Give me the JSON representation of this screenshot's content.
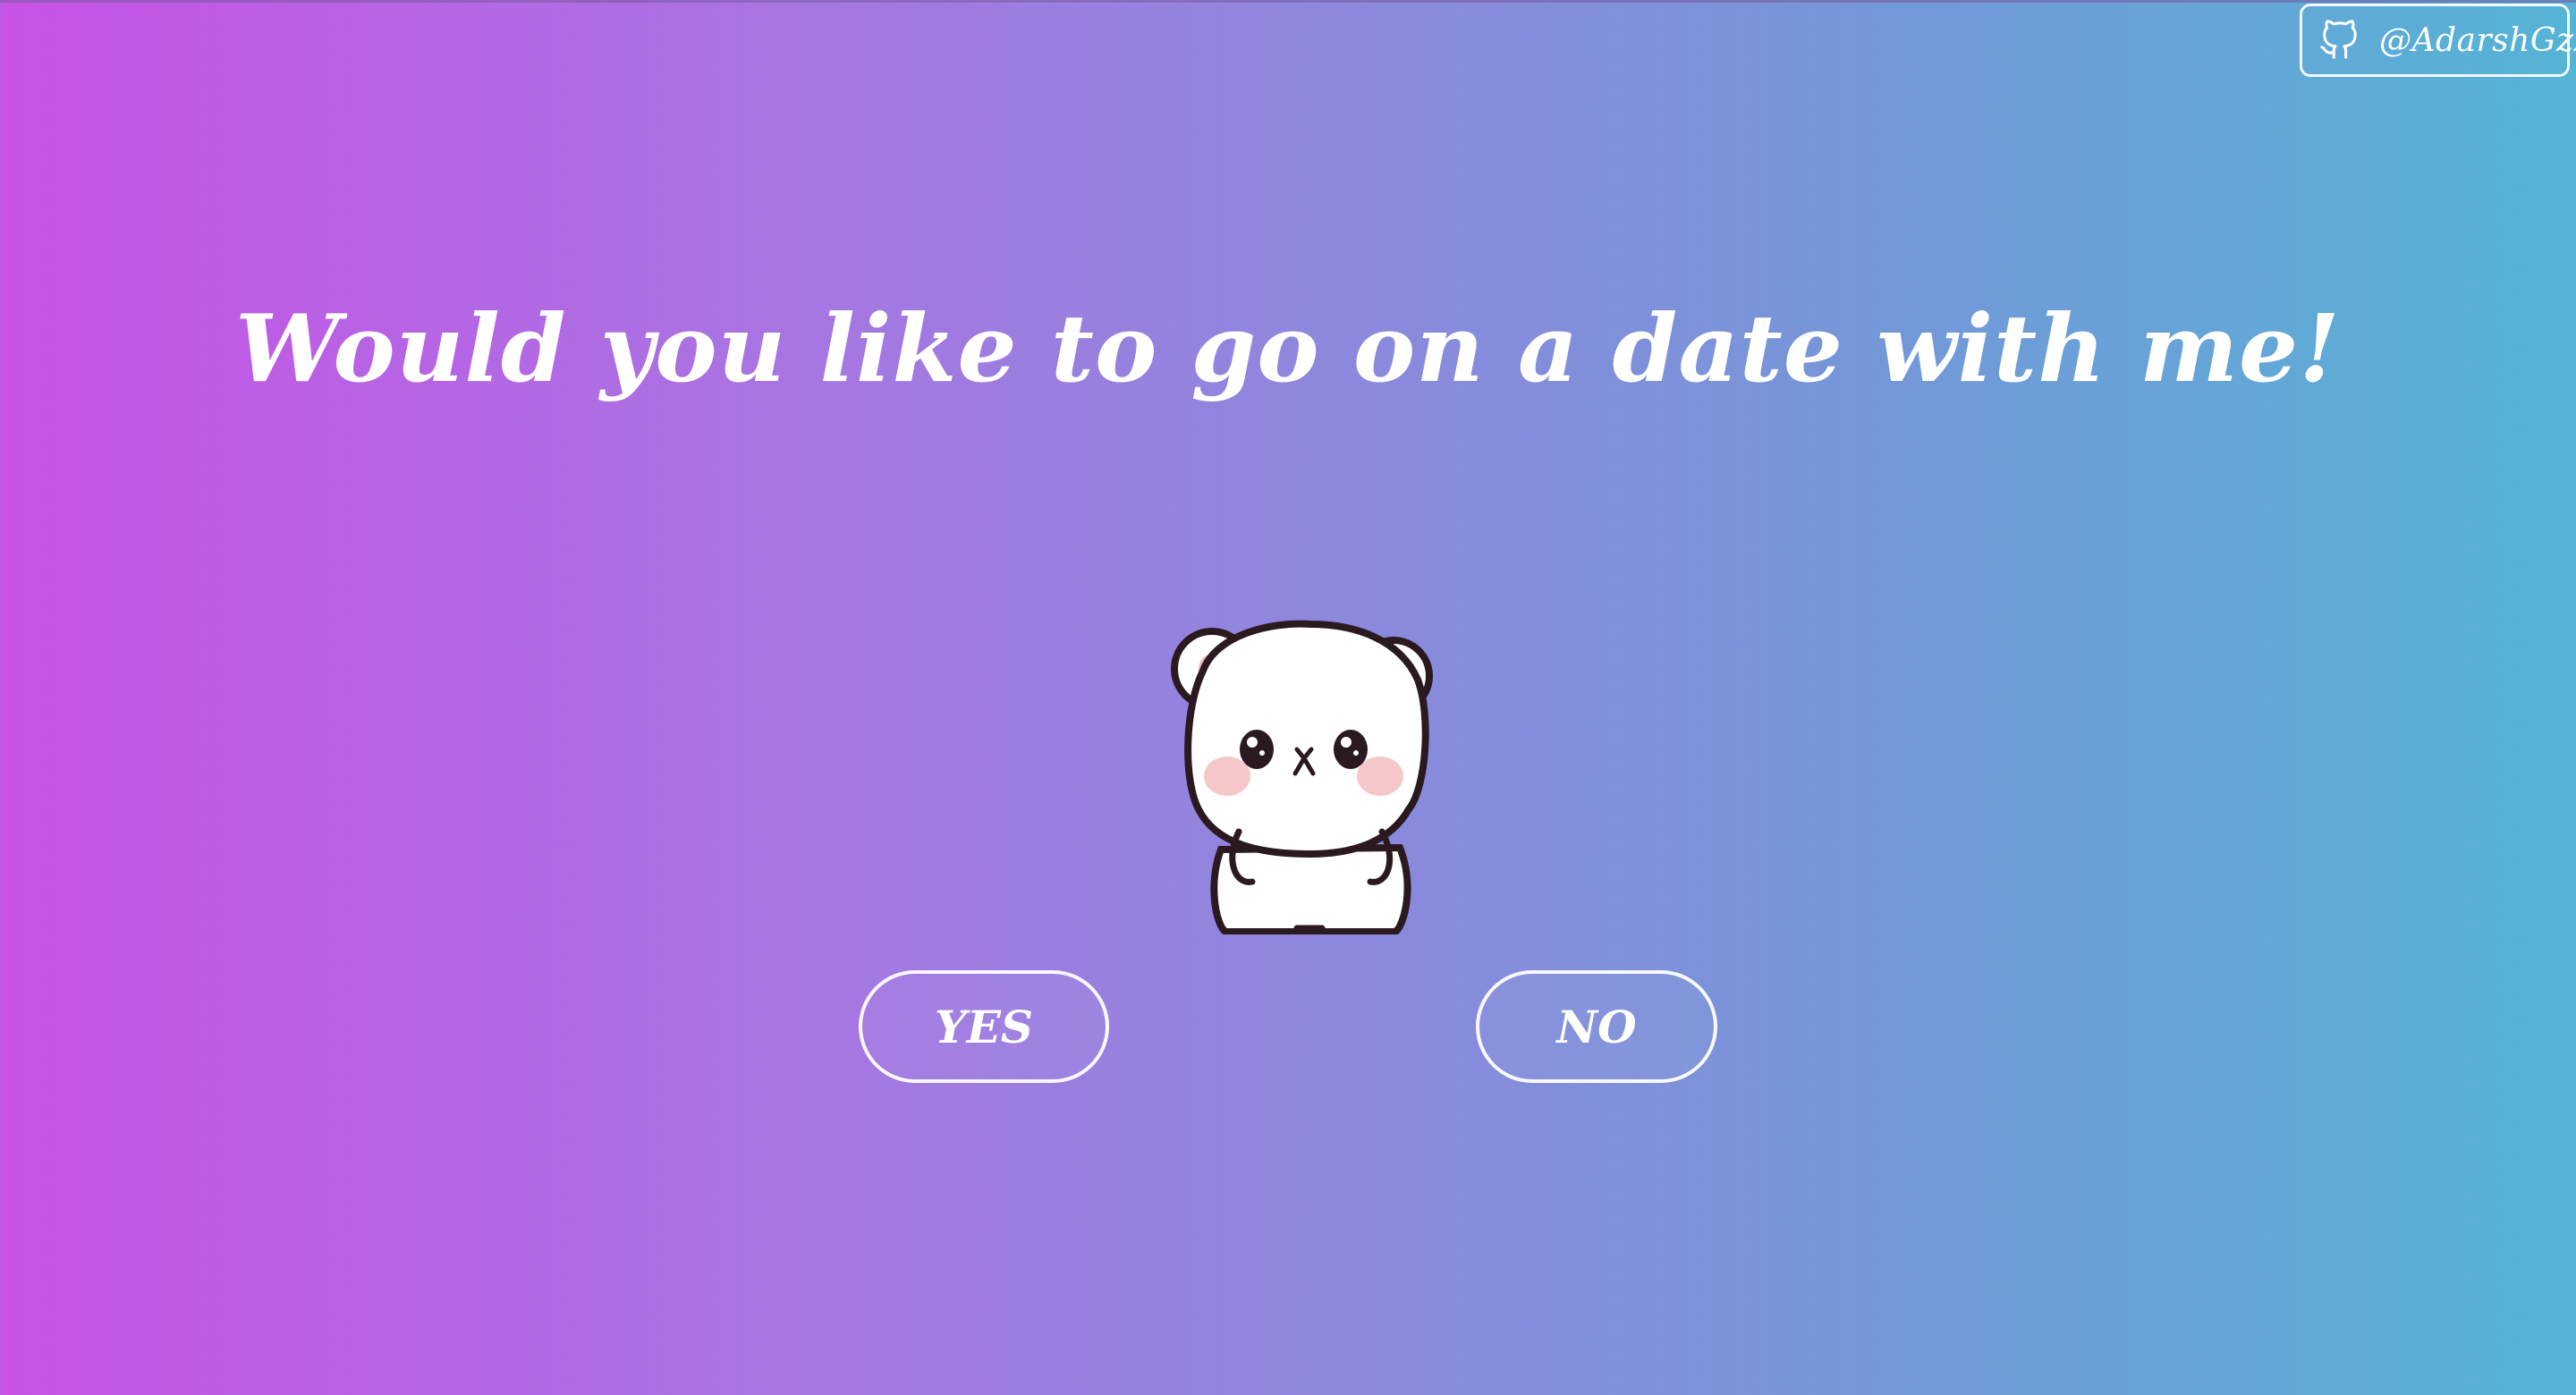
{
  "github_badge": {
    "handle": "@AdarshGzz",
    "icon": "github-icon"
  },
  "question": {
    "text": "Would you like to go on a date with me!"
  },
  "mascot": {
    "icon": "bear-icon"
  },
  "buttons": {
    "yes_label": "YES",
    "no_label": "NO"
  },
  "colors": {
    "gradient_start": "#c752e6",
    "gradient_end": "#55b4d6",
    "text": "#ffffff"
  }
}
